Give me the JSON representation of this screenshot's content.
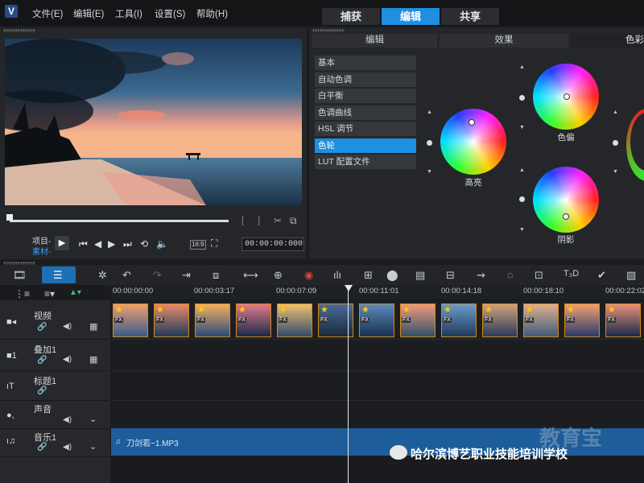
{
  "app": {
    "logo_text": "V"
  },
  "menu": {
    "file": "文件(E)",
    "edit": "编辑(E)",
    "tools": "工具(I)",
    "settings": "设置(S)",
    "help": "帮助(H)"
  },
  "mode_tabs": {
    "capture": "捕获",
    "edit": "编辑",
    "share": "共享",
    "active": "编辑"
  },
  "preview": {
    "mode_project": "项目-",
    "mode_clip": "素材-",
    "aspect": "16:9",
    "timecode": "00:00:00:000",
    "scrub_position": 0.0
  },
  "right_panel": {
    "tabs": {
      "edit": "编辑",
      "effects": "效果",
      "color": "色彩"
    },
    "categories": [
      "基本",
      "自动色调",
      "白平衡",
      "色调曲线",
      "HSL 调节",
      "色轮",
      "LUT 配置文件"
    ],
    "active_category": "色轮",
    "wheels": {
      "highlight": "高亮",
      "midtone": "色偏",
      "shadow": "阴影"
    }
  },
  "timeline": {
    "ruler_ticks": [
      "00:00:00:00",
      "00:00:03:17",
      "00:00:07:09",
      "00:00:11:01",
      "00:00:14:18",
      "00:00:18:10",
      "00:00:22:02"
    ],
    "tracks": [
      {
        "name": "视频"
      },
      {
        "name": "叠加1"
      },
      {
        "name": "标题1"
      },
      {
        "name": "声音"
      },
      {
        "name": "音乐1"
      }
    ],
    "clip_fx_label": "FX",
    "music_clip_name": "刀剑若~1.MP3"
  },
  "watermark": {
    "text": "哈尔滨博艺职业技能培训学校",
    "bg_text": "教育宝"
  },
  "colors": {
    "accent": "#1f8fe0",
    "clip_border": "#d38a16",
    "music_clip": "#1c5d9a"
  }
}
